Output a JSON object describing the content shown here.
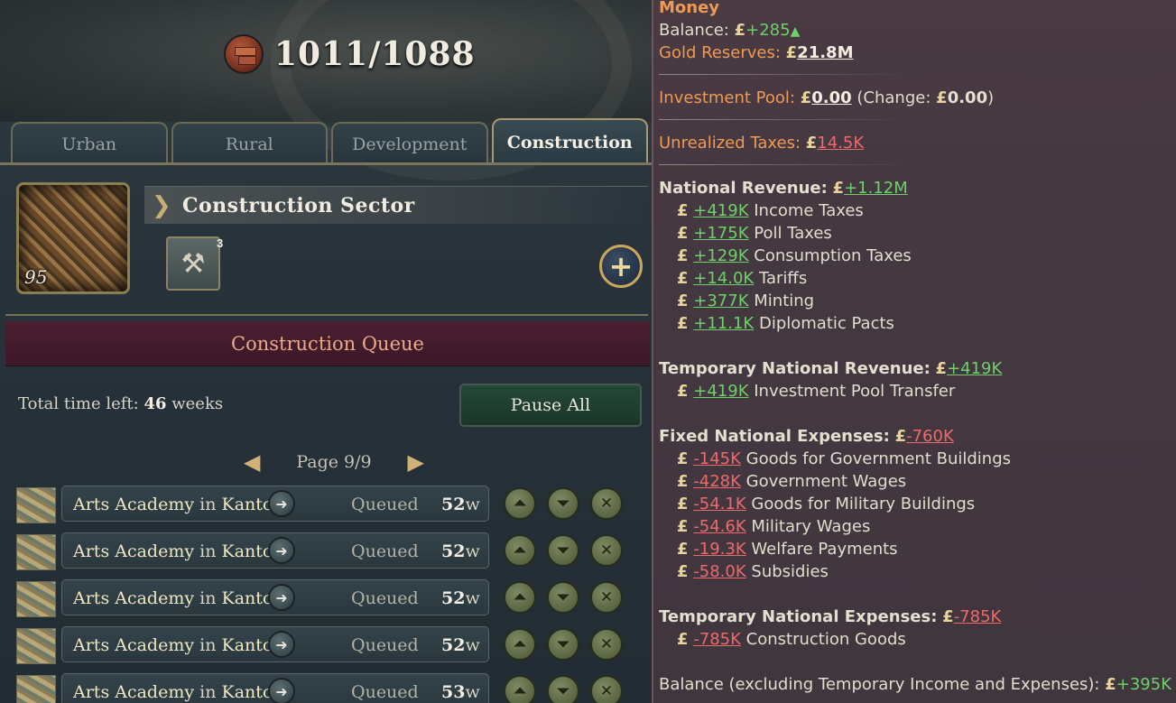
{
  "header": {
    "stat": "1011/1088",
    "icon": "brick-icon"
  },
  "tabs": [
    {
      "label": "Urban"
    },
    {
      "label": "Rural"
    },
    {
      "label": "Development"
    },
    {
      "label": "Construction",
      "active": true
    }
  ],
  "sector": {
    "name": "Construction Sector",
    "level": "95",
    "method_badge": "3",
    "add_icon": "+"
  },
  "queue": {
    "title": "Construction Queue",
    "time_left_label": "Total time left:",
    "time_left_value": "46",
    "time_left_unit": "weeks",
    "pause_all": "Pause All",
    "page": "Page 9/9",
    "rows": [
      {
        "building": "Arts Academy",
        "in": "in",
        "state": "Kanto",
        "status": "Queued",
        "weeks": "52",
        "unit": "w"
      },
      {
        "building": "Arts Academy",
        "in": "in",
        "state": "Kanto",
        "status": "Queued",
        "weeks": "52",
        "unit": "w"
      },
      {
        "building": "Arts Academy",
        "in": "in",
        "state": "Kanto",
        "status": "Queued",
        "weeks": "52",
        "unit": "w"
      },
      {
        "building": "Arts Academy",
        "in": "in",
        "state": "Kanto",
        "status": "Queued",
        "weeks": "52",
        "unit": "w"
      },
      {
        "building": "Arts Academy",
        "in": "in",
        "state": "Kanto",
        "status": "Queued",
        "weeks": "53",
        "unit": "w"
      }
    ]
  },
  "tooltip": {
    "title": "Money",
    "currency": "£",
    "balance_label": "Balance:",
    "balance_value": "+285",
    "gold_label": "Gold Reserves:",
    "gold_value": "21.8M",
    "investment_label": "Investment Pool:",
    "investment_value": "0.00",
    "investment_change_label": "(Change:",
    "investment_change_value": "0.00",
    "investment_close": ")",
    "unrealized_label": "Unrealized Taxes:",
    "unrealized_value": "14.5K",
    "revenue_label": "National Revenue:",
    "revenue_value": "+1.12M",
    "revenue_items": [
      {
        "value": "+419K",
        "label": "Income Taxes"
      },
      {
        "value": "+175K",
        "label": "Poll Taxes"
      },
      {
        "value": "+129K",
        "label": "Consumption Taxes"
      },
      {
        "value": "+14.0K",
        "label": "Tariffs"
      },
      {
        "value": "+377K",
        "label": "Minting"
      },
      {
        "value": "+11.1K",
        "label": "Diplomatic Pacts"
      }
    ],
    "temp_revenue_label": "Temporary National Revenue:",
    "temp_revenue_value": "+419K",
    "temp_revenue_items": [
      {
        "value": "+419K",
        "label": "Investment Pool Transfer"
      }
    ],
    "fixed_exp_label": "Fixed National Expenses:",
    "fixed_exp_value": "-760K",
    "fixed_exp_items": [
      {
        "value": "-145K",
        "label": "Goods for Government Buildings"
      },
      {
        "value": "-428K",
        "label": "Government Wages"
      },
      {
        "value": "-54.1K",
        "label": "Goods for Military Buildings"
      },
      {
        "value": "-54.6K",
        "label": "Military Wages"
      },
      {
        "value": "-19.3K",
        "label": "Welfare Payments"
      },
      {
        "value": "-58.0K",
        "label": "Subsidies"
      }
    ],
    "temp_exp_label": "Temporary National Expenses:",
    "temp_exp_value": "-785K",
    "temp_exp_items": [
      {
        "value": "-785K",
        "label": "Construction Goods"
      }
    ],
    "balance_excl_label": "Balance (excluding Temporary Income and Expenses):",
    "balance_excl_value": "+395K"
  }
}
